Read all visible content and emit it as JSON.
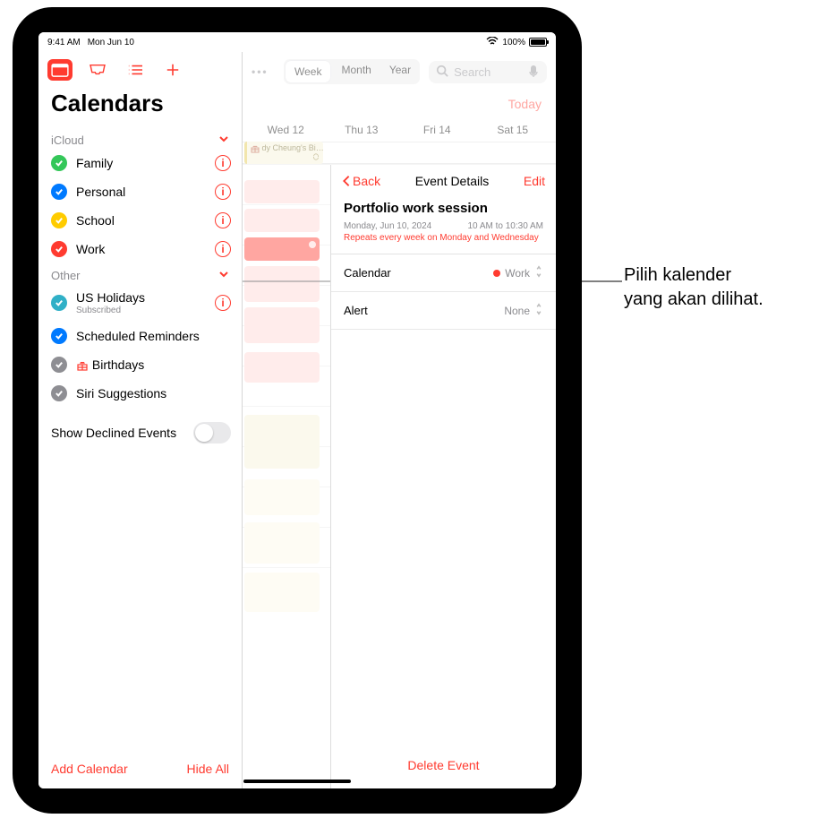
{
  "status": {
    "time": "9:41 AM",
    "date": "Mon Jun 10",
    "battery_pct": "100%"
  },
  "sidebar": {
    "title": "Calendars",
    "sections": [
      {
        "header": "iCloud",
        "items": [
          {
            "label": "Family",
            "color": "#34c759",
            "info": true,
            "checked": true
          },
          {
            "label": "Personal",
            "color": "#007aff",
            "info": true,
            "checked": true
          },
          {
            "label": "School",
            "color": "#ffcc00",
            "info": true,
            "checked": true
          },
          {
            "label": "Work",
            "color": "#ff3b30",
            "info": true,
            "checked": true
          }
        ]
      },
      {
        "header": "Other",
        "items": [
          {
            "label": "US Holidays",
            "sublabel": "Subscribed",
            "color": "#30b0c7",
            "info": true,
            "checked": true
          },
          {
            "label": "Scheduled Reminders",
            "color": "#007aff",
            "info": false,
            "checked": true
          },
          {
            "label": "Birthdays",
            "color": "#8e8e93",
            "info": false,
            "checked": true,
            "birthday_icon": true
          },
          {
            "label": "Siri Suggestions",
            "color": "#8e8e93",
            "info": false,
            "checked": true
          }
        ]
      }
    ],
    "declined_label": "Show Declined Events",
    "add_calendar": "Add Calendar",
    "hide_all": "Hide All"
  },
  "main": {
    "view_options": [
      "Week",
      "Month",
      "Year"
    ],
    "selected_view": "Week",
    "search_placeholder": "Search",
    "today": "Today",
    "days": [
      "Wed 12",
      "Thu 13",
      "Fri 14",
      "Sat 15"
    ],
    "allday_event": "dy Cheung's Bi…"
  },
  "detail": {
    "back": "Back",
    "heading": "Event Details",
    "edit": "Edit",
    "event_title": "Portfolio work session",
    "date_line": "Monday, Jun 10, 2024",
    "time_line": "10 AM to 10:30 AM",
    "repeat_line": "Repeats every week on Monday and Wednesday",
    "calendar_label": "Calendar",
    "calendar_value": "Work",
    "alert_label": "Alert",
    "alert_value": "None",
    "delete": "Delete Event"
  },
  "callout": {
    "line1": "Pilih kalender",
    "line2": "yang akan dilihat."
  }
}
